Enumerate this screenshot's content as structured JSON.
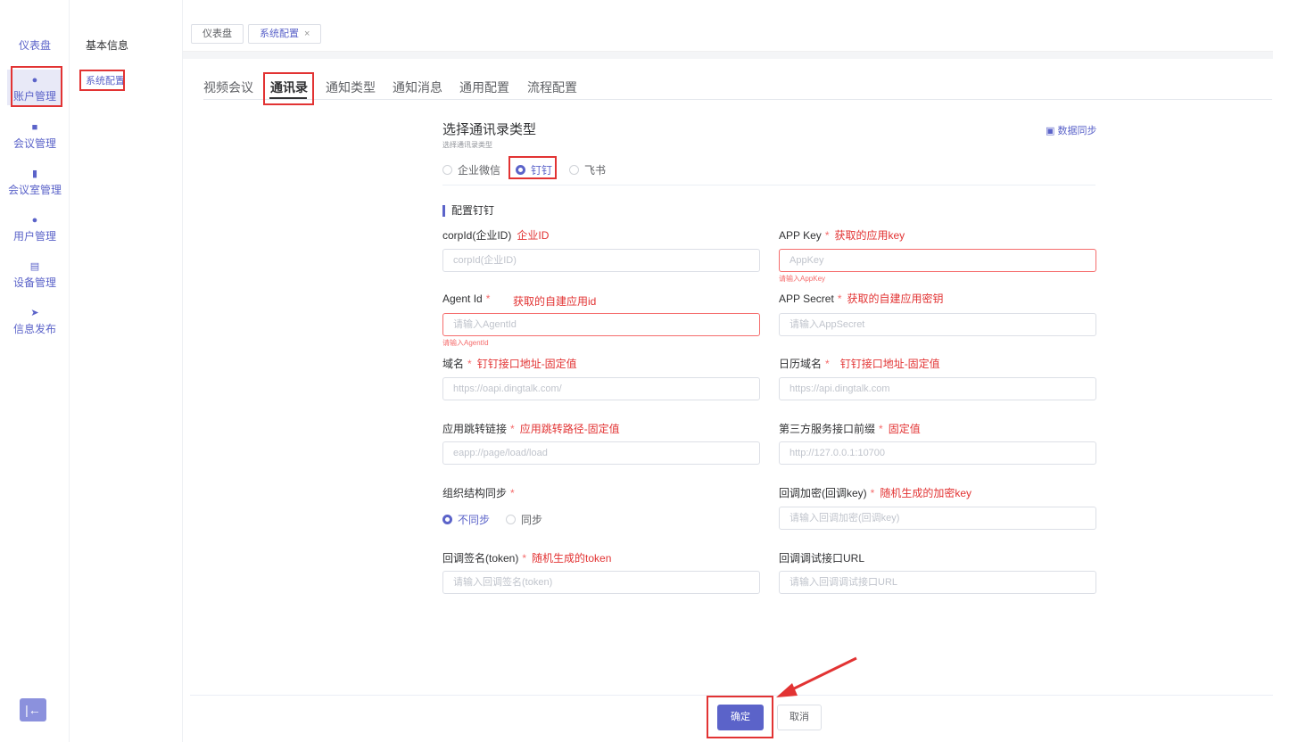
{
  "sidebar": {
    "items": [
      {
        "label": "仪表盘",
        "icon": ""
      },
      {
        "label": "账户管理",
        "icon": "person-icon"
      },
      {
        "label": "会议管理",
        "icon": "people-icon"
      },
      {
        "label": "会议室管理",
        "icon": "room-icon"
      },
      {
        "label": "用户管理",
        "icon": "person-icon"
      },
      {
        "label": "设备管理",
        "icon": "device-icon"
      },
      {
        "label": "信息发布",
        "icon": "send-icon"
      }
    ],
    "collapse_icon": "collapse-left-icon"
  },
  "submenu": {
    "items": [
      {
        "label": "基本信息"
      },
      {
        "label": "系统配置"
      }
    ]
  },
  "breadcrumbs": {
    "tags": [
      {
        "label": "仪表盘"
      },
      {
        "label": "系统配置",
        "close": "×"
      }
    ]
  },
  "tabs": [
    "视频会议",
    "通讯录",
    "通知类型",
    "通知消息",
    "通用配置",
    "流程配置"
  ],
  "section": {
    "title": "选择通讯录类型",
    "subtitle": "选择通讯录类型",
    "sync_label": "数据同步",
    "types": [
      "企业微信",
      "钉钉",
      "飞书"
    ],
    "group_title": "配置钉钉"
  },
  "fields": {
    "corp_id": {
      "label": "corpId(企业ID)",
      "note": "企业ID",
      "placeholder": "corpId(企业ID)"
    },
    "app_key": {
      "label": "APP Key",
      "req": "*",
      "note": "获取的应用key",
      "placeholder": "AppKey",
      "error": "请输入AppKey"
    },
    "agent_id": {
      "label": "Agent Id",
      "req": "*",
      "note": "获取的自建应用id",
      "placeholder": "请输入AgentId",
      "error": "请输入AgentId"
    },
    "app_secret": {
      "label": "APP Secret",
      "req": "*",
      "note": "获取的自建应用密钥",
      "placeholder": "请输入AppSecret"
    },
    "domain": {
      "label": "域名",
      "req": "*",
      "note": "钉钉接口地址-固定值",
      "placeholder": "https://oapi.dingtalk.com/"
    },
    "calendar_domain": {
      "label": "日历域名",
      "req": "*",
      "note": "钉钉接口地址-固定值",
      "placeholder": "https://api.dingtalk.com"
    },
    "jump_link": {
      "label": "应用跳转链接",
      "req": "*",
      "note": "应用跳转路径-固定值",
      "placeholder": "eapp://page/load/load"
    },
    "third_prefix": {
      "label": "第三方服务接口前缀",
      "req": "*",
      "note": "固定值",
      "placeholder": "http://127.0.0.1:10700"
    },
    "org_sync": {
      "label": "组织结构同步",
      "req": "*",
      "options": [
        "不同步",
        "同步"
      ]
    },
    "callback_key": {
      "label": "回调加密(回调key)",
      "req": "*",
      "note": "随机生成的加密key",
      "placeholder": "请输入回调加密(回调key)"
    },
    "callback_token": {
      "label": "回调签名(token)",
      "req": "*",
      "note": "随机生成的token",
      "placeholder": "请输入回调签名(token)"
    },
    "callback_url": {
      "label": "回调调试接口URL",
      "placeholder": "请输入回调调试接口URL"
    }
  },
  "footer": {
    "confirm": "确定",
    "cancel": "取消"
  },
  "colors": {
    "accent": "#5b63c9",
    "annotation": "#e23333",
    "error": "#f56c6c"
  }
}
